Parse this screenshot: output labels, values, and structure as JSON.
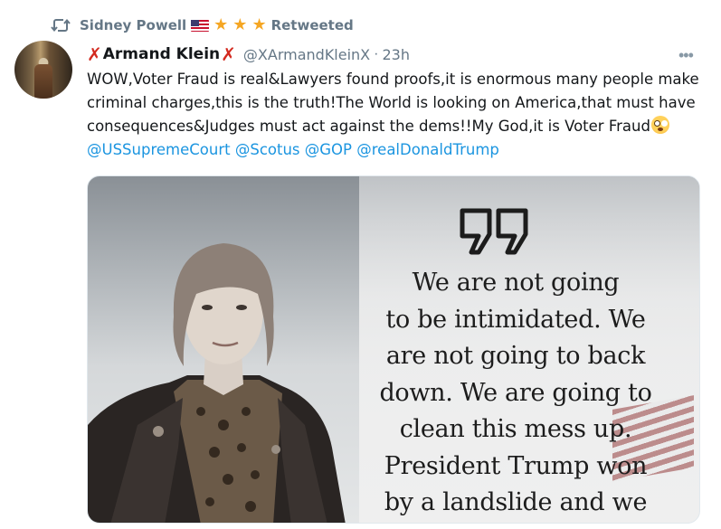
{
  "retweet": {
    "name": "Sidney Powell",
    "label": "Retweeted",
    "icon": "retweet-icon"
  },
  "author": {
    "display_name": "Armand Klein",
    "handle": "@XArmandKleinX",
    "separator": "·",
    "time": "23h",
    "name_decoration": "red-x-icon"
  },
  "tweet": {
    "text": "WOW,Voter Fraud is real&Lawyers found proofs,it is enormous many people make criminal charges,this is the truth!The World is looking on America,that must have consequences&Judges must act against the dems!!My God,it is Voter Fraud",
    "emoji": "flushed-face-icon",
    "mentions": [
      "@USSupremeCourt",
      "@Scotus",
      "@GOP",
      "@realDonaldTrump"
    ]
  },
  "media": {
    "quote_lines": [
      "We are not going",
      "to be intimidated. We",
      "are not going to back",
      "down. We are going to",
      "clean this mess up.",
      "President Trump won",
      "by a landslide and we"
    ]
  },
  "colors": {
    "accent": "#1b95e0",
    "muted": "#657786",
    "star": "#f5a623",
    "red_x": "#d32a1f"
  }
}
